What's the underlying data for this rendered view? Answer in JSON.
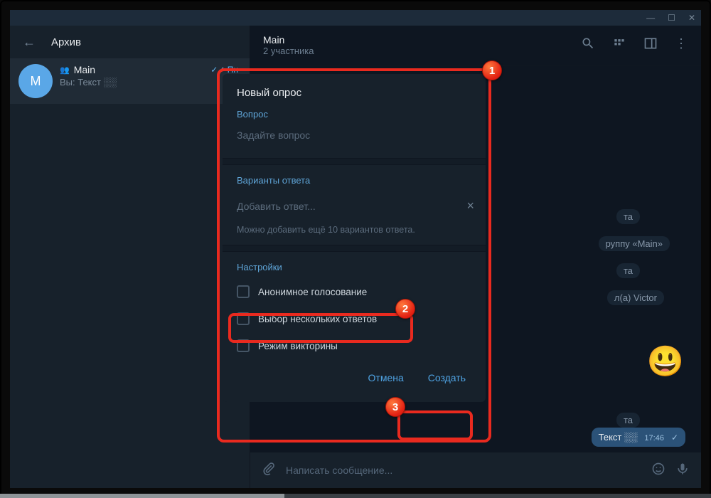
{
  "sidebar": {
    "header": "Архив",
    "chat": {
      "avatar_letter": "M",
      "title": "Main",
      "preview": "Вы: Текст ░░",
      "time_placeholder": "Пн"
    }
  },
  "chat_header": {
    "title": "Main",
    "subtitle": "2 участника"
  },
  "messages": {
    "pill1": "та",
    "pill2": "руппу «Main»",
    "pill3": "та",
    "pill4": "л(а) Victor",
    "pill5": "та",
    "emoji": "😃",
    "out_text": "Текст ░░",
    "out_time": "17:46"
  },
  "composer": {
    "placeholder": "Написать сообщение..."
  },
  "dialog": {
    "title": "Новый опрос",
    "question_label": "Вопрос",
    "question_placeholder": "Задайте вопрос",
    "options_label": "Варианты ответа",
    "add_option": "Добавить ответ...",
    "hint": "Можно добавить ещё 10 вариантов ответа.",
    "settings_label": "Настройки",
    "anon": "Анонимное голосование",
    "multi": "Выбор нескольких ответов",
    "quiz": "Режим викторины",
    "cancel": "Отмена",
    "create": "Создать"
  },
  "badges": {
    "b1": "1",
    "b2": "2",
    "b3": "3"
  }
}
